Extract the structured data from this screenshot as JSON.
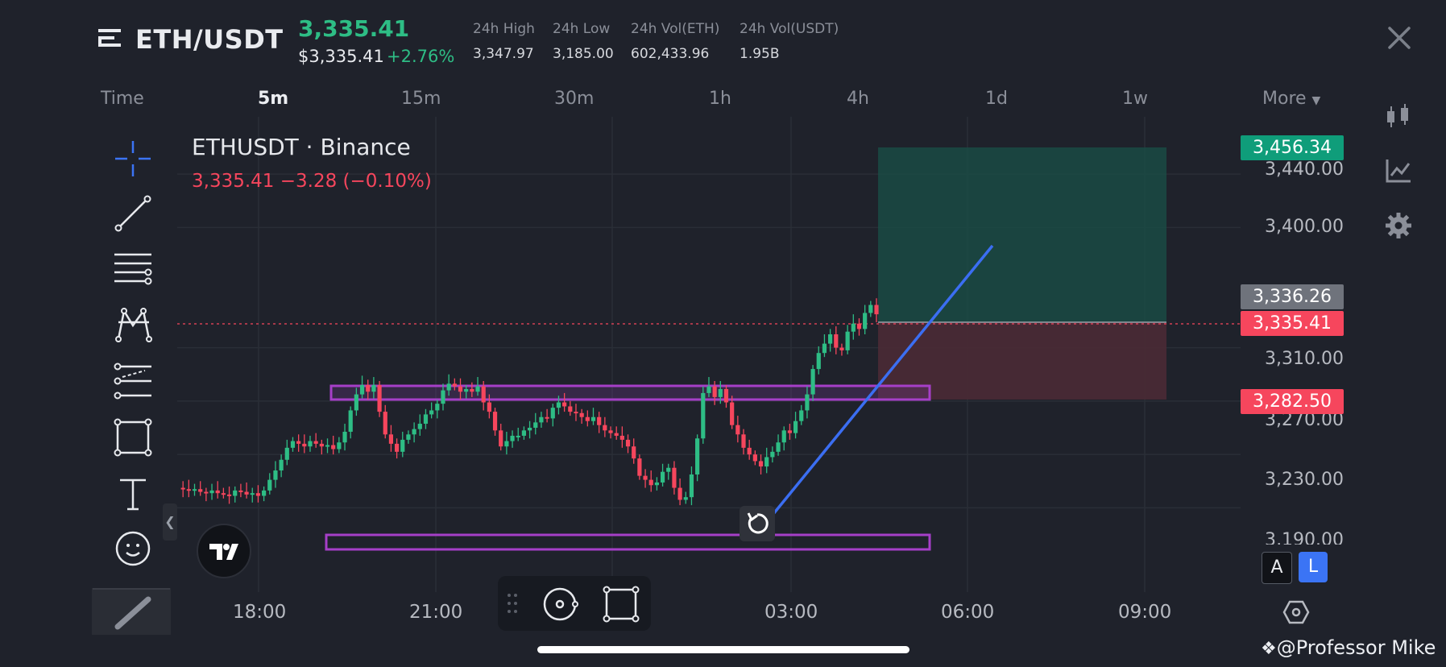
{
  "header": {
    "pair": "ETH/USDT",
    "last_price": "3,335.41",
    "usd_price": "$3,335.41",
    "change_pct": "+2.76%",
    "stats": [
      {
        "label": "24h High",
        "value": "3,347.97"
      },
      {
        "label": "24h Low",
        "value": "3,185.00"
      },
      {
        "label": "24h Vol(ETH)",
        "value": "602,433.96"
      },
      {
        "label": "24h Vol(USDT)",
        "value": "1.95B"
      }
    ]
  },
  "timeframes": {
    "time_label": "Time",
    "items": [
      "5m",
      "15m",
      "30m",
      "1h",
      "4h",
      "1d",
      "1w"
    ],
    "active": "5m",
    "more_label": "More"
  },
  "chart": {
    "symbol_label": "ETHUSDT · Binance",
    "ohlc_line": "3,335.41  −3.28 (−0.10%)",
    "price_levels": [
      "3,440.00",
      "3,400.00",
      "3,310.00",
      "3,270.00",
      "3,230.00",
      "3,190.00"
    ],
    "tags": [
      {
        "name": "target",
        "value": "3,456.34",
        "color": "#0f9d7a"
      },
      {
        "name": "entry",
        "value": "3,336.26",
        "color": "#6f737c"
      },
      {
        "name": "current",
        "value": "3,335.41",
        "color": "#f6465d"
      },
      {
        "name": "stop",
        "value": "3,282.50",
        "color": "#f6465d"
      }
    ],
    "time_labels": [
      "18:00",
      "21:00",
      "03:00",
      "06:00",
      "09:00"
    ],
    "buttons": {
      "a": "A",
      "l": "L"
    }
  },
  "colors": {
    "up": "#2ebd85",
    "down": "#f6465d",
    "accent": "#3b74f5",
    "zone": "#a63fc8"
  },
  "chart_data": {
    "type": "candlestick",
    "title": "ETHUSDT · Binance",
    "interval": "5m",
    "ylim": [
      3180,
      3460
    ],
    "close_series": [
      3205,
      3204,
      3203,
      3204,
      3202,
      3201,
      3203,
      3201,
      3200,
      3199,
      3203,
      3202,
      3200,
      3201,
      3199,
      3203,
      3211,
      3218,
      3226,
      3235,
      3240,
      3238,
      3236,
      3240,
      3238,
      3236,
      3237,
      3234,
      3239,
      3247,
      3263,
      3275,
      3282,
      3277,
      3282,
      3262,
      3245,
      3238,
      3232,
      3241,
      3245,
      3249,
      3253,
      3260,
      3263,
      3268,
      3278,
      3283,
      3281,
      3277,
      3279,
      3277,
      3281,
      3269,
      3262,
      3248,
      3236,
      3240,
      3244,
      3244,
      3248,
      3250,
      3254,
      3258,
      3257,
      3265,
      3269,
      3266,
      3262,
      3261,
      3258,
      3255,
      3258,
      3252,
      3248,
      3246,
      3244,
      3241,
      3236,
      3227,
      3214,
      3211,
      3207,
      3209,
      3217,
      3220,
      3205,
      3196,
      3198,
      3215,
      3242,
      3276,
      3281,
      3273,
      3279,
      3269,
      3252,
      3245,
      3235,
      3230,
      3225,
      3221,
      3228,
      3232,
      3239,
      3248,
      3246,
      3255,
      3263,
      3275,
      3294,
      3306,
      3313,
      3320,
      3310,
      3308,
      3322,
      3328,
      3324,
      3336,
      3342,
      3335
    ]
  }
}
